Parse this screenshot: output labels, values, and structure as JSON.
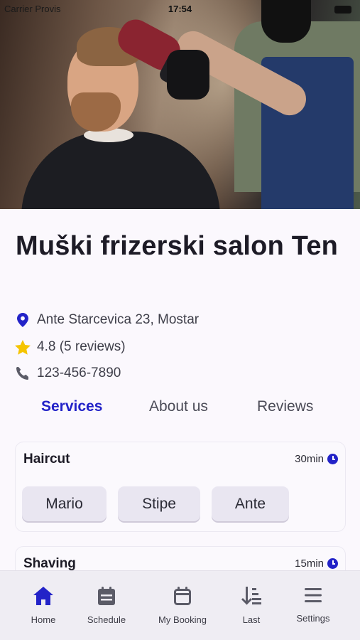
{
  "status_bar": {
    "carrier": "Carrier Provis",
    "time": "17:54"
  },
  "salon": {
    "name": "Muški frizerski salon Ten",
    "address": "Ante Starcevica 23, Mostar",
    "rating": "4.8 (5 reviews)",
    "phone": "123-456-7890"
  },
  "tabs": [
    {
      "label": "Services",
      "active": true
    },
    {
      "label": "About us",
      "active": false
    },
    {
      "label": "Reviews",
      "active": false
    }
  ],
  "services": [
    {
      "name": "Haircut",
      "duration": "30min",
      "barbers": [
        "Mario",
        "Stipe",
        "Ante"
      ]
    },
    {
      "name": "Shaving",
      "duration": "15min"
    }
  ],
  "nav": [
    {
      "label": "Home",
      "icon": "home-icon",
      "active": true
    },
    {
      "label": "Schedule",
      "icon": "schedule-icon",
      "active": false
    },
    {
      "label": "My Booking",
      "icon": "calendar-icon",
      "active": false
    },
    {
      "label": "Last",
      "icon": "sort-icon",
      "active": false
    },
    {
      "label": "Settings",
      "icon": "menu-icon",
      "active": false
    }
  ],
  "colors": {
    "accent": "#2323c8",
    "rating_star": "#f5c400",
    "background": "#fbf8fd"
  }
}
